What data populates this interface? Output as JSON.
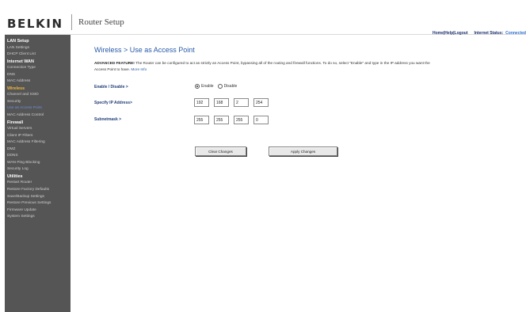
{
  "header": {
    "logo": "BELKIN",
    "title": "Router Setup",
    "links": [
      "Home",
      "Help",
      "Logout"
    ],
    "status_label": "Internet Status:",
    "status_value": "Connected"
  },
  "sidebar": {
    "items": [
      {
        "label": "LAN Setup",
        "kind": "head"
      },
      {
        "label": "LAN Settings",
        "kind": "link"
      },
      {
        "label": "DHCP Client List",
        "kind": "link"
      },
      {
        "label": "Internet WAN",
        "kind": "head"
      },
      {
        "label": "Connection Type",
        "kind": "link"
      },
      {
        "label": "DNS",
        "kind": "link"
      },
      {
        "label": "MAC Address",
        "kind": "link"
      },
      {
        "label": "Wireless",
        "kind": "active-section"
      },
      {
        "label": "Channel and SSID",
        "kind": "link"
      },
      {
        "label": "Security",
        "kind": "link"
      },
      {
        "label": "Use as Access Point",
        "kind": "current"
      },
      {
        "label": "MAC Address Control",
        "kind": "link"
      },
      {
        "label": "Firewall",
        "kind": "head"
      },
      {
        "label": "Virtual Servers",
        "kind": "link"
      },
      {
        "label": "Client IP Filters",
        "kind": "link"
      },
      {
        "label": "MAC Address Filtering",
        "kind": "link"
      },
      {
        "label": "DMZ",
        "kind": "link"
      },
      {
        "label": "DDNS",
        "kind": "link"
      },
      {
        "label": "WAN Ping Blocking",
        "kind": "link"
      },
      {
        "label": "Security Log",
        "kind": "link"
      },
      {
        "label": "Utilities",
        "kind": "head"
      },
      {
        "label": "Restart Router",
        "kind": "link"
      },
      {
        "label": "Restore Factory Defaults",
        "kind": "link"
      },
      {
        "label": "Save/Backup Settings",
        "kind": "link"
      },
      {
        "label": "Restore Previous Settings",
        "kind": "link"
      },
      {
        "label": "Firmware Update",
        "kind": "link"
      },
      {
        "label": "System Settings",
        "kind": "link"
      }
    ]
  },
  "main": {
    "title": "Wireless > Use as Access Point",
    "desc_bold": "ADVANCED FEATURE!",
    "desc_text": " The Router can be configured to act as strictly an Access Point, bypassing all of the routing and firewall functions. To do so, select \"Enable\" and type in the IP address you want the Access Point to have. ",
    "more_info": "More Info",
    "enable_label": "Enable / Disable >",
    "enable_option": "Enable",
    "disable_option": "Disable",
    "enable_selected": "Enable",
    "ip_label": "Specify IP Address>",
    "ip": [
      "192",
      "168",
      "2",
      "254"
    ],
    "mask_label": "Subnetmask >",
    "mask": [
      "255",
      "255",
      "255",
      "0"
    ],
    "clear_button": "Clear Changes",
    "apply_button": "Apply Changes"
  },
  "colors": {
    "sidebar_bg": "#555555",
    "title_blue": "#2a5ba8",
    "label_navy": "#1f3c7a",
    "active_section": "#f0b43c",
    "current_item": "#6f8fd6"
  }
}
